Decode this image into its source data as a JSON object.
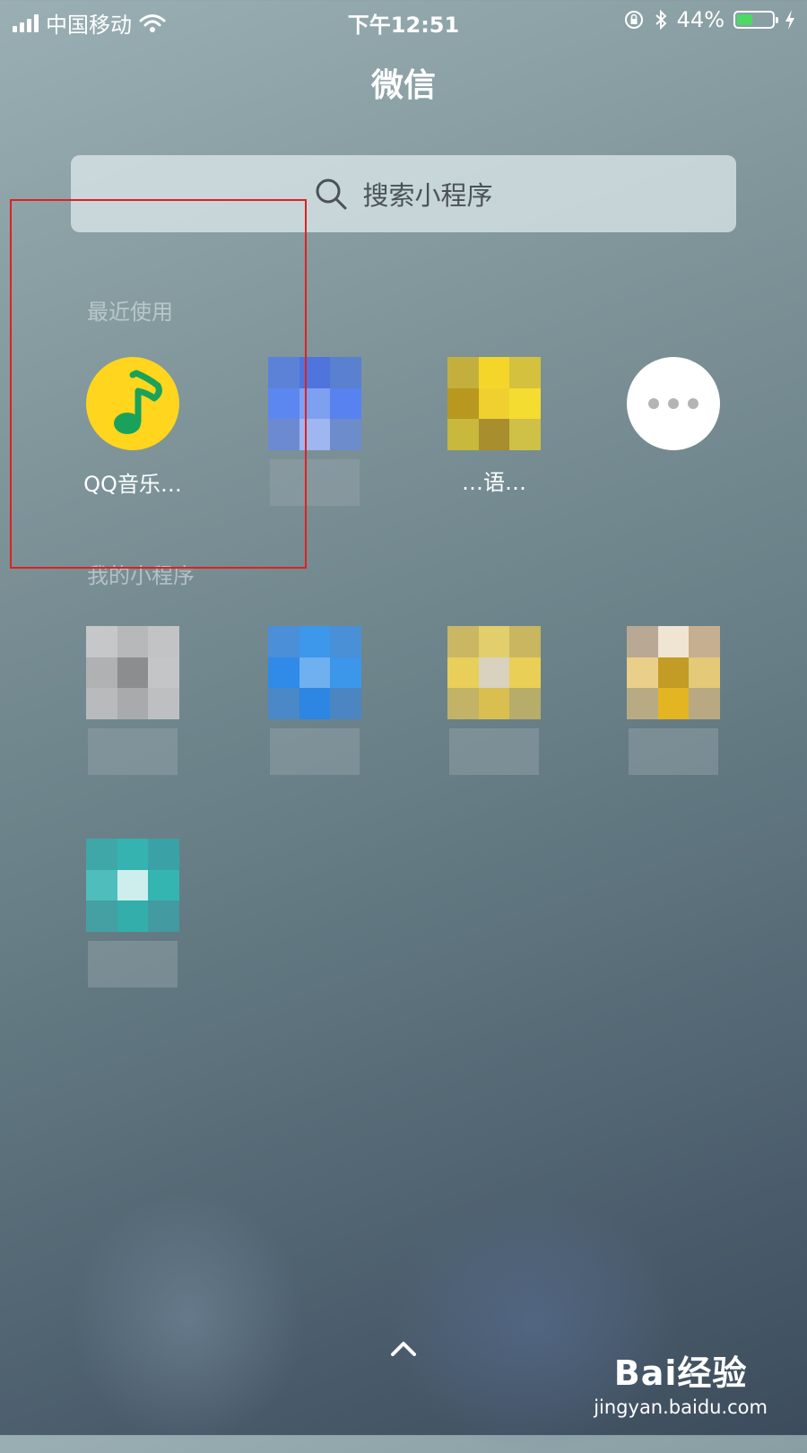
{
  "status_bar": {
    "carrier": "中国移动",
    "time": "下午12:51",
    "battery_percent": "44%",
    "battery_level": 0.44,
    "icons": [
      "signal-icon",
      "wifi-icon",
      "rotation-lock-icon",
      "bluetooth-icon",
      "battery-icon",
      "charging-icon"
    ]
  },
  "title": "微信",
  "search": {
    "placeholder": "搜索小程序",
    "icon": "search-icon"
  },
  "recent": {
    "label": "最近使用",
    "apps": [
      {
        "name": "QQ音乐…",
        "icon": "qq-music-icon",
        "color": "#ffd51e"
      },
      {
        "name": "",
        "icon": "blurred-app-icon"
      },
      {
        "name": "…语…",
        "icon": "blurred-app-icon"
      },
      {
        "name": "",
        "icon": "more-icon"
      }
    ]
  },
  "mine": {
    "label": "我的小程序",
    "apps": [
      {
        "icon": "blurred-app-icon"
      },
      {
        "icon": "blurred-app-icon"
      },
      {
        "icon": "blurred-app-icon"
      },
      {
        "icon": "blurred-app-icon"
      },
      {
        "icon": "blurred-app-icon"
      }
    ]
  },
  "footer": {
    "icon": "chevron-up-icon"
  },
  "watermark": {
    "logo": "Bai经验",
    "url": "jingyan.baidu.com"
  },
  "colors": {
    "highlight_box": "#e02020",
    "battery": "#4cd964"
  }
}
